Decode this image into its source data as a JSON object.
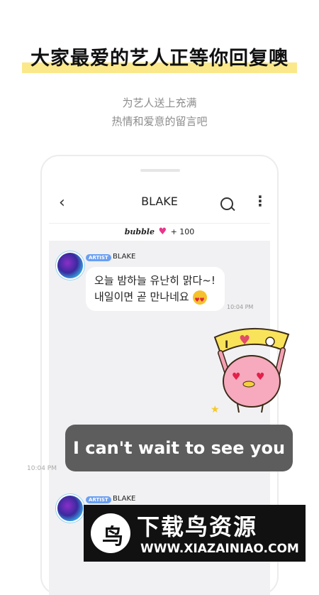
{
  "promo": {
    "headline": "大家最爱的艺人正等你回复噢",
    "sub1": "为艺人送上充满",
    "sub2": "热情和爱意的留言吧"
  },
  "chat": {
    "title": "BLAKE",
    "bubble_brand": "bubble",
    "bubble_count": "+ 100",
    "messages": [
      {
        "tag": "ARTIST",
        "sender": "BLAKE",
        "line1": "오늘 밤하늘 유난히 맑다~!",
        "line2": "내일이면 곧 만나네요",
        "time": "10:04 PM"
      },
      {
        "tag": "ARTIST",
        "sender": "BLAKE"
      }
    ],
    "sticker_text": "I ♥ ↄ",
    "reply": {
      "text": "I can't wait to see you",
      "time": "10:04 PM"
    }
  },
  "watermark": {
    "title": "下载鸟资源",
    "url": "WWW.XIAZAINIAO.COM",
    "logo_glyph": "鸟"
  }
}
